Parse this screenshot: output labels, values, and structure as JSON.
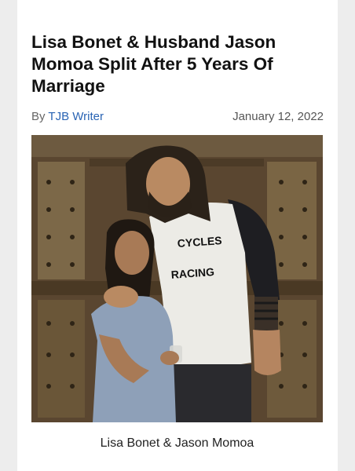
{
  "article": {
    "headline": "Lisa Bonet & Husband Jason Momoa Split After 5 Years Of Marriage",
    "byline_prefix": "By",
    "author": "TJB Writer",
    "date": "January 12, 2022",
    "photo": {
      "shirt_text_line1": "CYCLES",
      "shirt_text_line2": "RACING"
    },
    "caption": "Lisa Bonet & Jason Momoa"
  },
  "colors": {
    "page_background": "#ededed",
    "article_background": "#ffffff",
    "author_link": "#2a64b4",
    "headline_text": "#111111"
  }
}
